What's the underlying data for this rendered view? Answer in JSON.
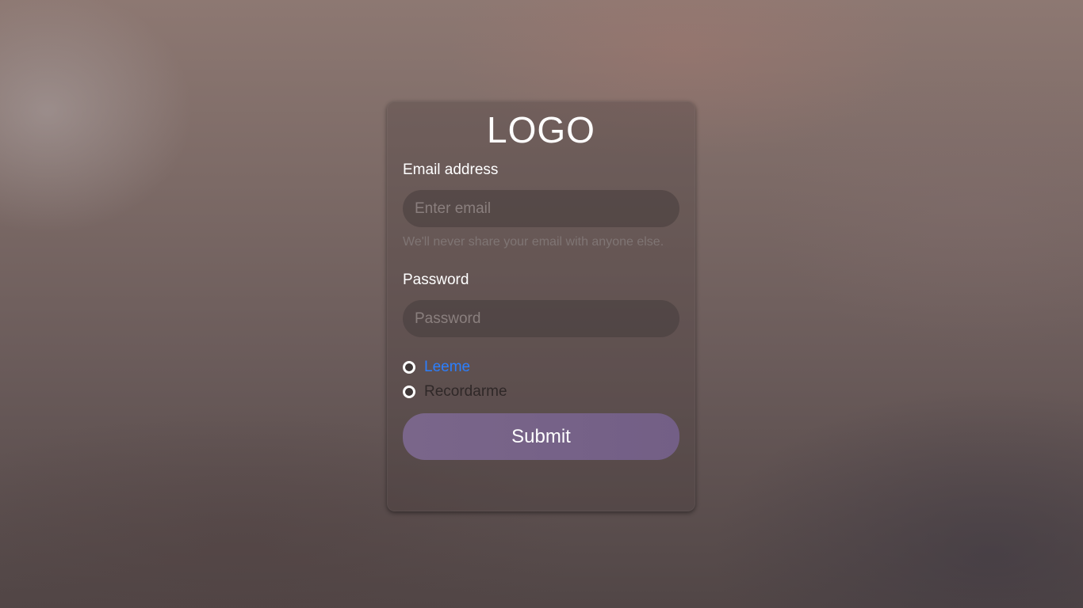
{
  "logo": {
    "text": "LOGO"
  },
  "form": {
    "email": {
      "label": "Email address",
      "placeholder": "Enter email",
      "value": "",
      "help": "We'll never share your email with anyone else."
    },
    "password": {
      "label": "Password",
      "placeholder": "Password",
      "value": ""
    },
    "options": [
      {
        "label": "Leeme",
        "color": "#2b7fff"
      },
      {
        "label": "Recordarme",
        "color": "#2f2828"
      }
    ],
    "submit_label": "Submit"
  },
  "colors": {
    "accent_button": "#76628a",
    "link": "#2b7fff",
    "text_primary": "#ffffff",
    "help_text": "#7f7574"
  }
}
